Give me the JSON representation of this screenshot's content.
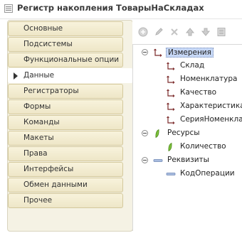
{
  "window": {
    "title": "Регистр накопления ТоварыНаСкладах"
  },
  "nav": {
    "items": [
      {
        "label": "Основные"
      },
      {
        "label": "Подсистемы"
      },
      {
        "label": "Функциональные опции"
      },
      {
        "label": "Данные",
        "selected": true
      },
      {
        "label": "Регистраторы"
      },
      {
        "label": "Формы"
      },
      {
        "label": "Команды"
      },
      {
        "label": "Макеты"
      },
      {
        "label": "Права"
      },
      {
        "label": "Интерфейсы"
      },
      {
        "label": "Обмен данными"
      },
      {
        "label": "Прочее"
      }
    ]
  },
  "toolbar": {
    "buttons": [
      "add-icon",
      "edit-icon",
      "delete-icon",
      "move-up-icon",
      "move-down-icon",
      "sort-icon"
    ]
  },
  "tree": {
    "groups": [
      {
        "label": "Измерения",
        "icon": "dimension-icon",
        "children": [
          "Склад",
          "Номенклатура",
          "Качество",
          "ХарактеристикаН",
          "СерияНоменклат"
        ]
      },
      {
        "label": "Ресурсы",
        "icon": "resource-icon",
        "children": [
          "Количество"
        ]
      },
      {
        "label": "Реквизиты",
        "icon": "attribute-icon",
        "children": [
          "КодОперации"
        ]
      }
    ]
  },
  "colors": {
    "nav_bg": "#f5f2e4",
    "tab_bg": "#eee6c7",
    "selection": "#c7d8f6",
    "resource_green": "#7cc23a",
    "attribute_blue": "#7a97c7"
  }
}
